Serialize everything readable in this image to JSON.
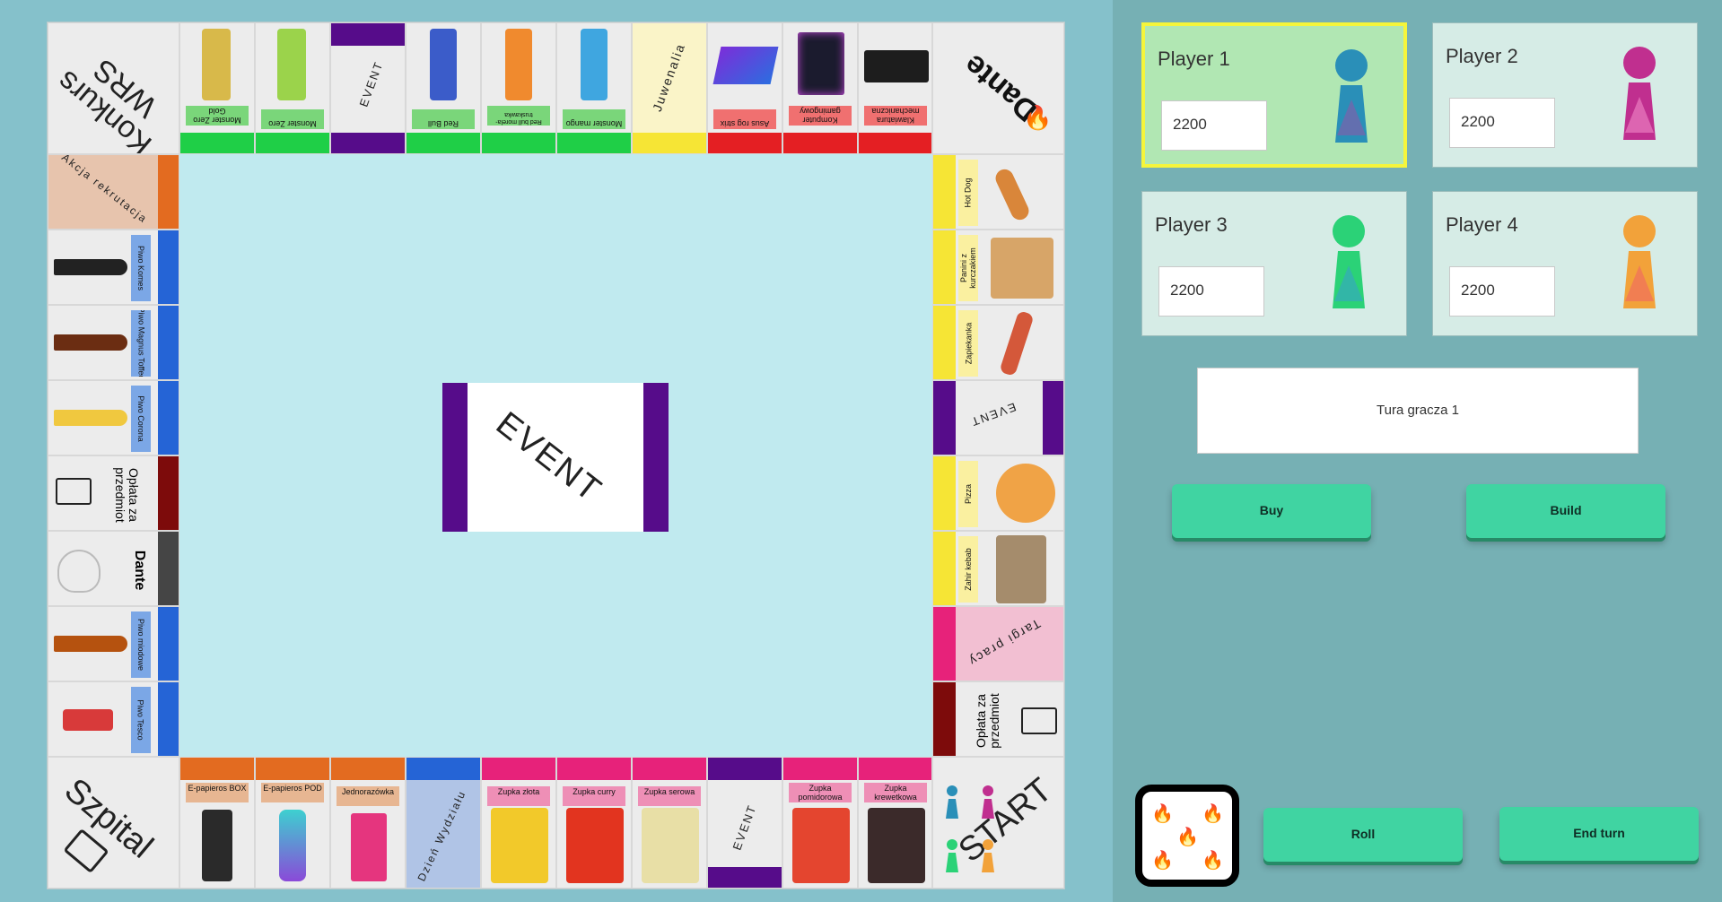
{
  "board": {
    "corners": {
      "top_left": "Konkurs WRS",
      "top_right": "Dante",
      "bottom_left": "Szpital",
      "bottom_right": "START"
    },
    "center_event": "EVENT",
    "top": [
      {
        "label": "Monster Zero Gold",
        "color": "#1fcf47"
      },
      {
        "label": "Monster Zero",
        "color": "#1fcf47"
      },
      {
        "label": "EVENT",
        "color": "#560c8a"
      },
      {
        "label": "Red Bull",
        "color": "#1fcf47"
      },
      {
        "label": "Red bull morela-truskawka",
        "color": "#1fcf47"
      },
      {
        "label": "Monster mango",
        "color": "#1fcf47"
      },
      {
        "label": "Juwenalia",
        "color": "#f6e535"
      },
      {
        "label": "Asus rog strix",
        "color": "#e41f23"
      },
      {
        "label": "Komputer gamingowy",
        "color": "#e41f23"
      },
      {
        "label": "Klawiatura mechaniczna",
        "color": "#e41f23"
      }
    ],
    "left": [
      {
        "label": "Akcja rekrutacja",
        "color": "#e36b20"
      },
      {
        "label": "Piwo Komes",
        "color": "#2564d6"
      },
      {
        "label": "Piwo Magnus Toffee",
        "color": "#2564d6"
      },
      {
        "label": "Piwo Corona",
        "color": "#2564d6"
      },
      {
        "label": "Opłata za przedmiot",
        "color": "#7d0b0b"
      },
      {
        "label": "Dante",
        "color": "#454545"
      },
      {
        "label": "Piwo miodowe",
        "color": "#2564d6"
      },
      {
        "label": "Piwo Tesco",
        "color": "#2564d6"
      }
    ],
    "right": [
      {
        "label": "Hot Dog",
        "color": "#f6e535"
      },
      {
        "label": "Panini z kurczakiem",
        "color": "#f6e535"
      },
      {
        "label": "Zapiekanka",
        "color": "#f6e535"
      },
      {
        "label": "EVENT",
        "color": "#560c8a"
      },
      {
        "label": "Pizza",
        "color": "#f6e535"
      },
      {
        "label": "Zahir kebab",
        "color": "#f6e535"
      },
      {
        "label": "Targi pracy",
        "color": "#e7227a"
      },
      {
        "label": "Opłata za przedmiot",
        "color": "#7d0b0b"
      }
    ],
    "bottom": [
      {
        "label": "E-papieros BOX",
        "color": "#e36b20"
      },
      {
        "label": "E-papieros POD",
        "color": "#e36b20"
      },
      {
        "label": "Jednorazówka",
        "color": "#e36b20"
      },
      {
        "label": "Dzień Wydziału",
        "color": "#2564d6"
      },
      {
        "label": "Zupka złota",
        "color": "#e7227a"
      },
      {
        "label": "Zupka curry",
        "color": "#e7227a"
      },
      {
        "label": "Zupka serowa",
        "color": "#e7227a"
      },
      {
        "label": "EVENT",
        "color": "#560c8a"
      },
      {
        "label": "Zupka pomidorowa",
        "color": "#e7227a"
      },
      {
        "label": "Zupka krewetkowa",
        "color": "#e7227a"
      }
    ]
  },
  "players": [
    {
      "name": "Player 1",
      "money": "2200",
      "active": true,
      "pawn_color": "#2a8fb8"
    },
    {
      "name": "Player 2",
      "money": "2200",
      "active": false,
      "pawn_color": "#c02f8f"
    },
    {
      "name": "Player 3",
      "money": "2200",
      "active": false,
      "pawn_color": "#2bd277"
    },
    {
      "name": "Player 4",
      "money": "2200",
      "active": false,
      "pawn_color": "#f2a23a"
    }
  ],
  "status_text": "Tura gracza 1",
  "buttons": {
    "buy": "Buy",
    "build": "Build",
    "roll": "Roll",
    "end_turn": "End turn"
  },
  "dice": {
    "value": 5,
    "icon": "flame-icon"
  }
}
